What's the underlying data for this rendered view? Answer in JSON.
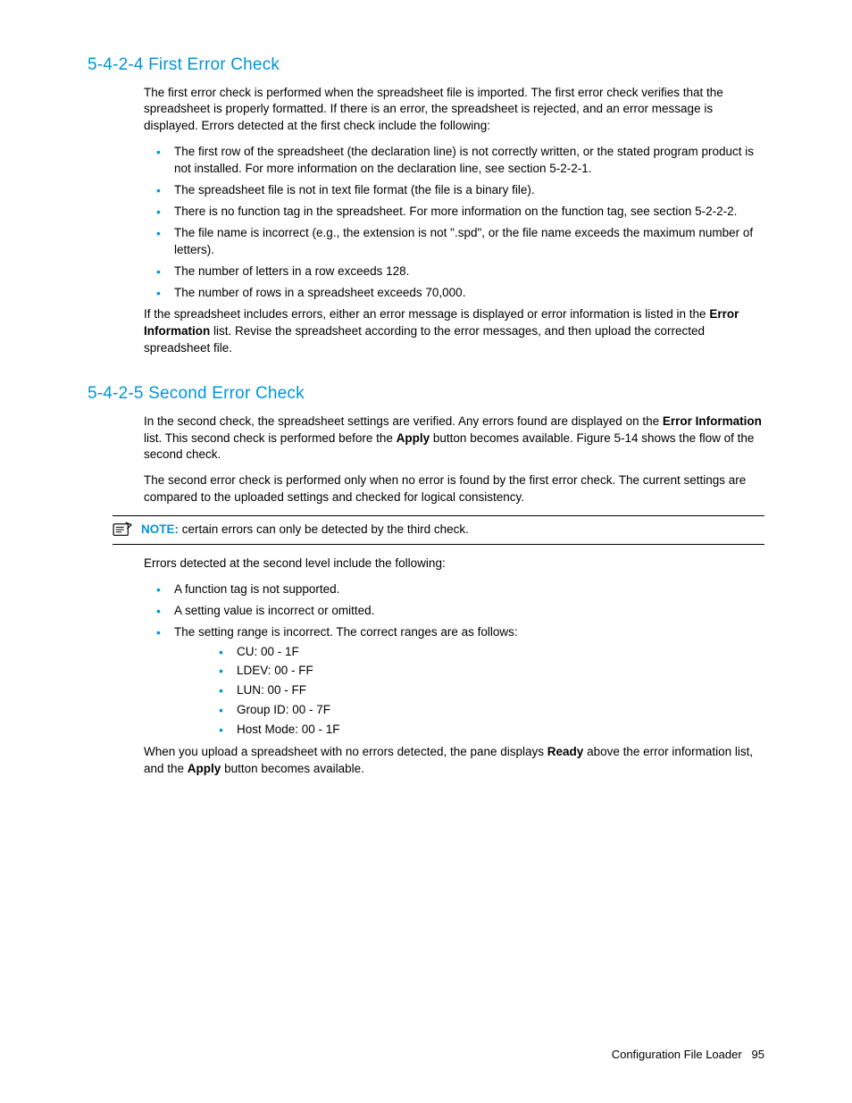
{
  "section1": {
    "heading": "5-4-2-4 First Error Check",
    "intro": "The first error check is performed when the spreadsheet file is imported. The first error check verifies that the spreadsheet is properly formatted. If there is an error, the spreadsheet is rejected, and an error message is displayed. Errors detected at the first check include the following:",
    "bullets": [
      "The first row of the spreadsheet (the declaration line) is not correctly written, or the stated program product is not installed. For more information on the declaration line, see section 5-2-2-1.",
      "The spreadsheet file is not in text file format (the file is a binary file).",
      "There is no function tag in the spreadsheet. For more information on the function tag, see section 5-2-2-2.",
      "The file name is incorrect (e.g., the extension is not \".spd\", or the file name exceeds the maximum number of letters).",
      "The number of letters in a row exceeds 128.",
      "The number of rows in a spreadsheet exceeds 70,000."
    ],
    "after_pre": "If the spreadsheet includes errors, either an error message is displayed or error information is listed in the ",
    "after_bold1": "Error Information",
    "after_post": " list. Revise the spreadsheet according to the error messages, and then upload the corrected spreadsheet file."
  },
  "section2": {
    "heading": "5-4-2-5 Second Error Check",
    "p1_a": "In the second check, the spreadsheet settings are verified. Any errors found are displayed on the ",
    "p1_b1": "Error Information",
    "p1_c": " list. This second check is performed before the ",
    "p1_b2": "Apply",
    "p1_d": " button becomes available. Figure 5-14 shows the flow of the second check.",
    "p2": "The second error check is performed only when no error is found by the first error check. The current settings are compared to the uploaded settings and checked for logical consistency.",
    "note_label": "NOTE:",
    "note_text": "  certain errors can only be detected by the third check.",
    "p3": "Errors detected at the second level include the following:",
    "bullets": [
      "A function tag is not supported.",
      "A setting value is incorrect or omitted.",
      "The setting range is incorrect. The correct ranges are as follows:"
    ],
    "subbullets": [
      "CU:  00 - 1F",
      "LDEV:  00 - FF",
      "LUN:  00 - FF",
      "Group ID:  00 - 7F",
      "Host Mode:  00 - 1F"
    ],
    "p4_a": "When you upload a spreadsheet with no errors detected, the pane displays ",
    "p4_b1": "Ready",
    "p4_c": " above the error information list, and the ",
    "p4_b2": "Apply",
    "p4_d": " button becomes available."
  },
  "footer": {
    "title": "Configuration File Loader",
    "page": "95"
  }
}
